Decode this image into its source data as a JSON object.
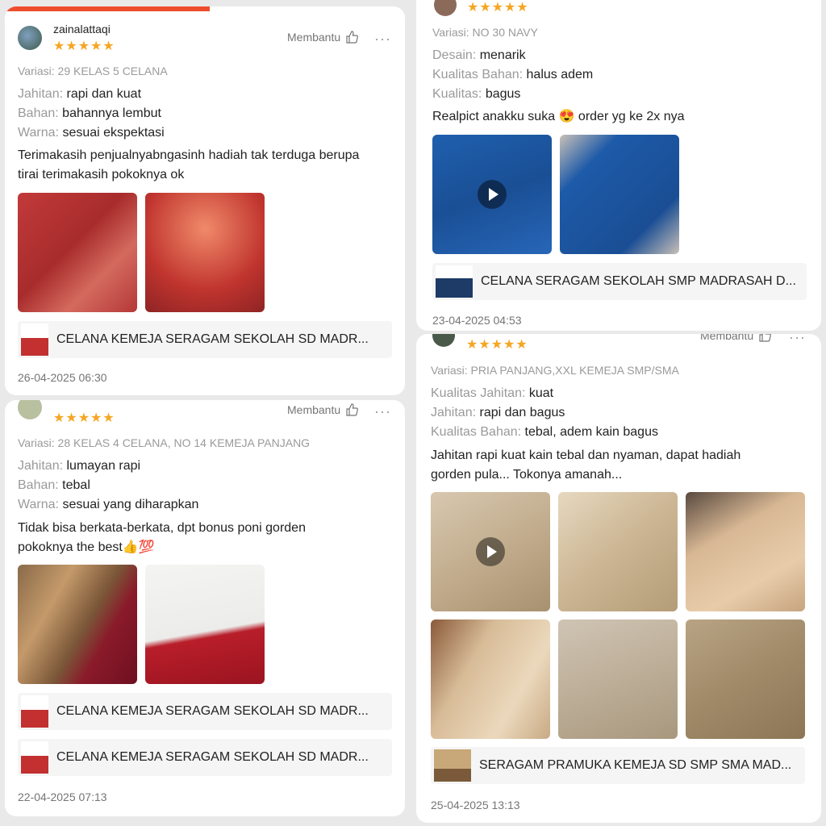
{
  "colors": {
    "star": "#f5a623",
    "accent": "#ee4d2d",
    "muted": "#9a9a9a"
  },
  "reviews": [
    {
      "user": "zainalattaqi",
      "stars": "★★★★★",
      "helpful": "Membantu",
      "more": "···",
      "variant": "Variasi: 29 KELAS 5 CELANA",
      "attributes": [
        {
          "key": "Jahitan:",
          "value": "rapi dan kuat"
        },
        {
          "key": "Bahan:",
          "value": "bahannya lembut"
        },
        {
          "key": "Warna:",
          "value": "sesuai ekspektasi"
        }
      ],
      "text_lines": [
        "Terimakasih penjualnyabngasinh hadiah tak terduga berupa",
        "tirai terimakasih pokoknya ok"
      ],
      "products": [
        "CELANA KEMEJA SERAGAM SEKOLAH SD MADR..."
      ],
      "date": "26-04-2025 06:30"
    },
    {
      "user": "",
      "stars": "★★★★★",
      "helpful": "",
      "more": "",
      "variant": "Variasi: NO 30 NAVY",
      "attributes": [
        {
          "key": "Desain:",
          "value": "menarik"
        },
        {
          "key": "Kualitas Bahan:",
          "value": "halus adem"
        },
        {
          "key": "Kualitas:",
          "value": "bagus"
        }
      ],
      "text_lines": [
        "Realpict anakku suka",
        "order yg ke 2x nya"
      ],
      "emoji": "😍",
      "products": [
        "CELANA SERAGAM SEKOLAH SMP MADRASAH D..."
      ],
      "date": "23-04-2025 04:53"
    },
    {
      "user": "",
      "stars": "★★★★★",
      "helpful": "Membantu",
      "more": "···",
      "variant": "Variasi: 28 KELAS 4 CELANA, NO 14 KEMEJA PANJANG",
      "attributes": [
        {
          "key": "Jahitan:",
          "value": "lumayan rapi"
        },
        {
          "key": "Bahan:",
          "value": "tebal"
        },
        {
          "key": "Warna:",
          "value": "sesuai yang diharapkan"
        }
      ],
      "text_lines": [
        "Tidak bisa berkata-berkata, dpt bonus poni gorden",
        "pokoknya the best👍💯"
      ],
      "products": [
        "CELANA KEMEJA SERAGAM SEKOLAH SD MADR...",
        "CELANA KEMEJA SERAGAM SEKOLAH SD MADR..."
      ],
      "date": "22-04-2025 07:13"
    },
    {
      "user": "",
      "stars": "★★★★★",
      "helpful": "Membantu",
      "more": "···",
      "variant": "Variasi: PRIA PANJANG,XXL KEMEJA  SMP/SMA",
      "attributes": [
        {
          "key": "Kualitas Jahitan:",
          "value": "kuat"
        },
        {
          "key": "Jahitan:",
          "value": "rapi dan bagus"
        },
        {
          "key": "Kualitas Bahan:",
          "value": "tebal, adem kain bagus"
        }
      ],
      "text_lines": [
        "Jahitan rapi kuat kain tebal dan nyaman, dapat hadiah",
        "gorden pula... Tokonya amanah..."
      ],
      "products": [
        "SERAGAM PRAMUKA KEMEJA SD SMP SMA MAD..."
      ],
      "date": "25-04-2025 13:13"
    }
  ]
}
